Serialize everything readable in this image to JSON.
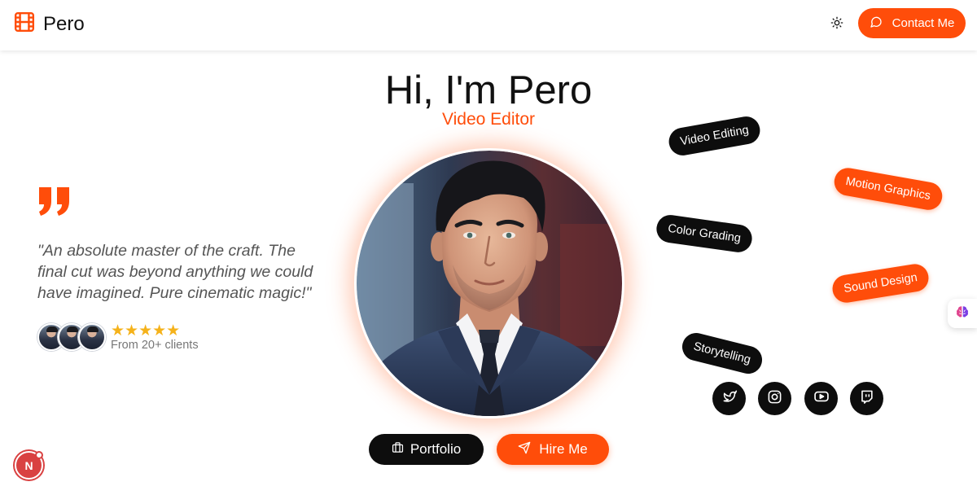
{
  "brand": {
    "name": "Pero",
    "icon": "film-icon"
  },
  "header": {
    "theme_icon": "sun-icon",
    "contact_label": "Contact Me",
    "contact_icon": "message-circle-icon"
  },
  "hero": {
    "title": "Hi, I'm Pero",
    "subtitle": "Video Editor"
  },
  "testimonial": {
    "quote_icon": "quote-icon",
    "lines": [
      "\"An absolute master of the craft. The",
      "final cut was beyond anything we could",
      "have imagined. Pure cinematic magic!\""
    ],
    "stars": "★★★★★",
    "rating": 5,
    "clients_text": "From 20+ clients"
  },
  "skills": [
    {
      "label": "Video Editing",
      "style": "dark"
    },
    {
      "label": "Motion Graphics",
      "style": "orange"
    },
    {
      "label": "Color Grading",
      "style": "dark"
    },
    {
      "label": "Sound Design",
      "style": "orange"
    },
    {
      "label": "Storytelling",
      "style": "dark"
    }
  ],
  "social": [
    "twitter-icon",
    "instagram-icon",
    "youtube-icon",
    "twitch-icon"
  ],
  "buttons": {
    "portfolio_label": "Portfolio",
    "portfolio_icon": "briefcase-icon",
    "hire_label": "Hire Me",
    "hire_icon": "send-icon"
  },
  "widgets": {
    "side_icon": "brain-icon",
    "badge_label": "N"
  },
  "colors": {
    "accent": "#ff4d0a",
    "dark": "#0d0d0d",
    "star": "#f5b21a"
  }
}
